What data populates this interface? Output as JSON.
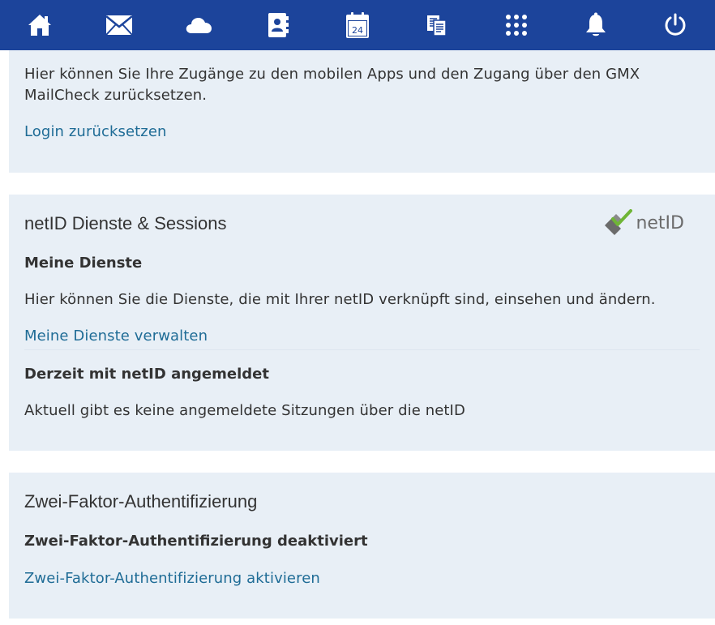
{
  "nav": {
    "items": [
      {
        "name": "home-icon"
      },
      {
        "name": "mail-icon"
      },
      {
        "name": "cloud-icon"
      },
      {
        "name": "address-book-icon"
      },
      {
        "name": "calendar-icon",
        "label": "24"
      },
      {
        "name": "documents-icon"
      },
      {
        "name": "apps-grid-icon"
      },
      {
        "name": "bell-icon"
      },
      {
        "name": "power-icon"
      }
    ],
    "bg_color": "#1c449b"
  },
  "reset": {
    "description": "Hier können Sie Ihre Zugänge zu den mobilen Apps und den Zugang über den GMX",
    "description_line2": "MailCheck zurücksetzen.",
    "link": "Login zurücksetzen"
  },
  "netid": {
    "title": "netID Dienste & Sessions",
    "logo_text": "netID",
    "services_heading": "Meine Dienste",
    "services_text": "Hier können Sie die Dienste, die mit Ihrer netID verknüpft sind, einsehen und ändern.",
    "services_link": "Meine Dienste verwalten",
    "sessions_heading": "Derzeit mit netID angemeldet",
    "sessions_text": "Aktuell gibt es keine angemeldete Sitzungen über die netID"
  },
  "twofactor": {
    "title": "Zwei-Faktor-Authentifizierung",
    "status": "Zwei-Faktor-Authentifizierung deaktiviert",
    "link": "Zwei-Faktor-Authentifizierung aktivieren"
  },
  "colors": {
    "card_bg": "#e8eff6",
    "link": "#1f6c96",
    "text": "#333333"
  }
}
